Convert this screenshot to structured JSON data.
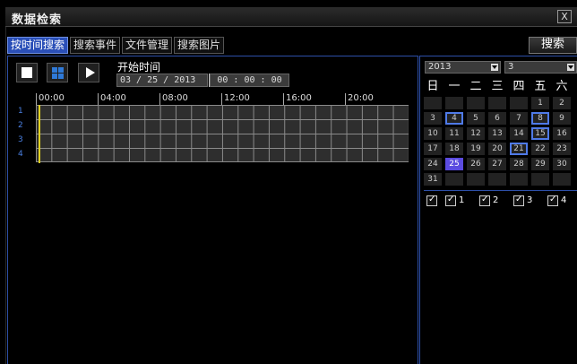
{
  "window": {
    "title": "数据检索",
    "close_label": "X"
  },
  "tabs": [
    {
      "label": "按时间搜索",
      "active": true
    },
    {
      "label": "搜索事件",
      "active": false
    },
    {
      "label": "文件管理",
      "active": false
    },
    {
      "label": "搜索图片",
      "active": false
    }
  ],
  "search_button": "搜索",
  "controls": {
    "stop": "stop-icon",
    "split": "quad-split-icon",
    "play": "play-icon"
  },
  "start_time": {
    "label": "开始时间",
    "date": "03 / 25 / 2013",
    "date_icon_label": "25",
    "time": "00 : 00 : 00"
  },
  "timeline": {
    "hours": [
      "00:00",
      "04:00",
      "08:00",
      "12:00",
      "16:00",
      "20:00"
    ],
    "channels": [
      "1",
      "2",
      "3",
      "4"
    ]
  },
  "calendar": {
    "year": "2013",
    "month": "3",
    "weekdays": [
      "日",
      "一",
      "二",
      "三",
      "四",
      "五",
      "六"
    ],
    "rows": [
      [
        "",
        "",
        "",
        "",
        "",
        "1",
        "2"
      ],
      [
        "3",
        "4",
        "5",
        "6",
        "7",
        "8",
        "9"
      ],
      [
        "10",
        "11",
        "12",
        "13",
        "14",
        "15",
        "16"
      ],
      [
        "17",
        "18",
        "19",
        "20",
        "21",
        "22",
        "23"
      ],
      [
        "24",
        "25",
        "26",
        "27",
        "28",
        "29",
        "30"
      ],
      [
        "31",
        "",
        "",
        "",
        "",
        "",
        ""
      ]
    ],
    "record_days": [
      "4",
      "8",
      "15",
      "21"
    ],
    "selected_day": "25"
  },
  "channel_checks": {
    "all_checked": true,
    "channels": [
      "1",
      "2",
      "3",
      "4"
    ]
  },
  "colors": {
    "accent": "#2a4fb8",
    "cursor": "#e0d020",
    "record_border": "#4f7ae8",
    "selected_day": "#5b4be0"
  }
}
